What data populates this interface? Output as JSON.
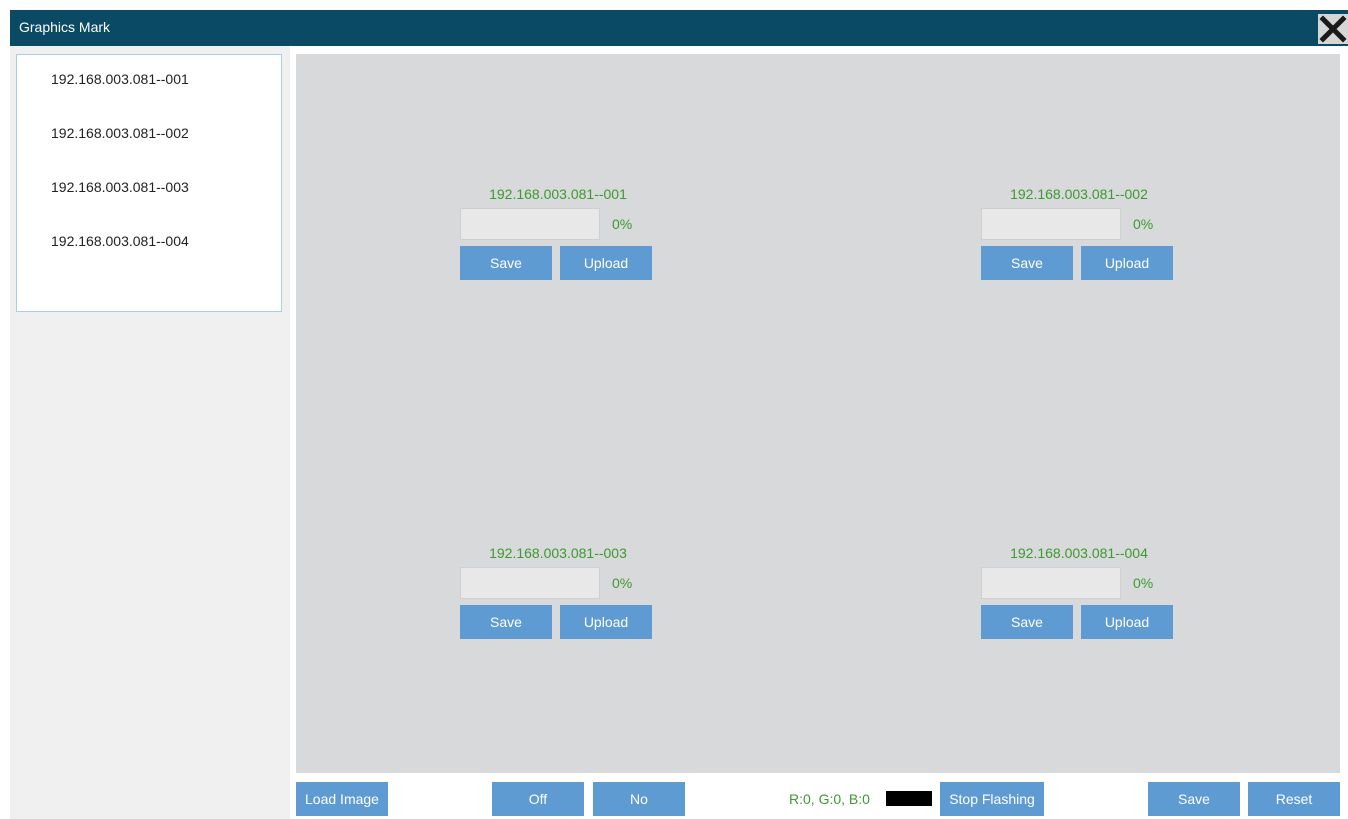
{
  "window": {
    "title": "Graphics Mark",
    "close_icon": "close-icon"
  },
  "sidebar": {
    "devices": [
      "192.168.003.081--001",
      "192.168.003.081--002",
      "192.168.003.081--003",
      "192.168.003.081--004"
    ]
  },
  "panels": [
    {
      "name": "192.168.003.081--001",
      "progress": 0,
      "percent_label": "0%",
      "save_label": "Save",
      "upload_label": "Upload"
    },
    {
      "name": "192.168.003.081--002",
      "progress": 0,
      "percent_label": "0%",
      "save_label": "Save",
      "upload_label": "Upload"
    },
    {
      "name": "192.168.003.081--003",
      "progress": 0,
      "percent_label": "0%",
      "save_label": "Save",
      "upload_label": "Upload"
    },
    {
      "name": "192.168.003.081--004",
      "progress": 0,
      "percent_label": "0%",
      "save_label": "Save",
      "upload_label": "Upload"
    }
  ],
  "toolbar": {
    "load_image_label": "Load Image",
    "off_label": "Off",
    "no_label": "No",
    "rgb_text": "R:0, G:0, B:0",
    "current_color": "#000000",
    "stop_flashing_label": "Stop Flashing",
    "save_label": "Save",
    "reset_label": "Reset"
  },
  "colors": {
    "title_bar": "#0b4a64",
    "button": "#5f9bd3",
    "status_text": "#3c9a2f",
    "canvas": "#d8d9da"
  }
}
